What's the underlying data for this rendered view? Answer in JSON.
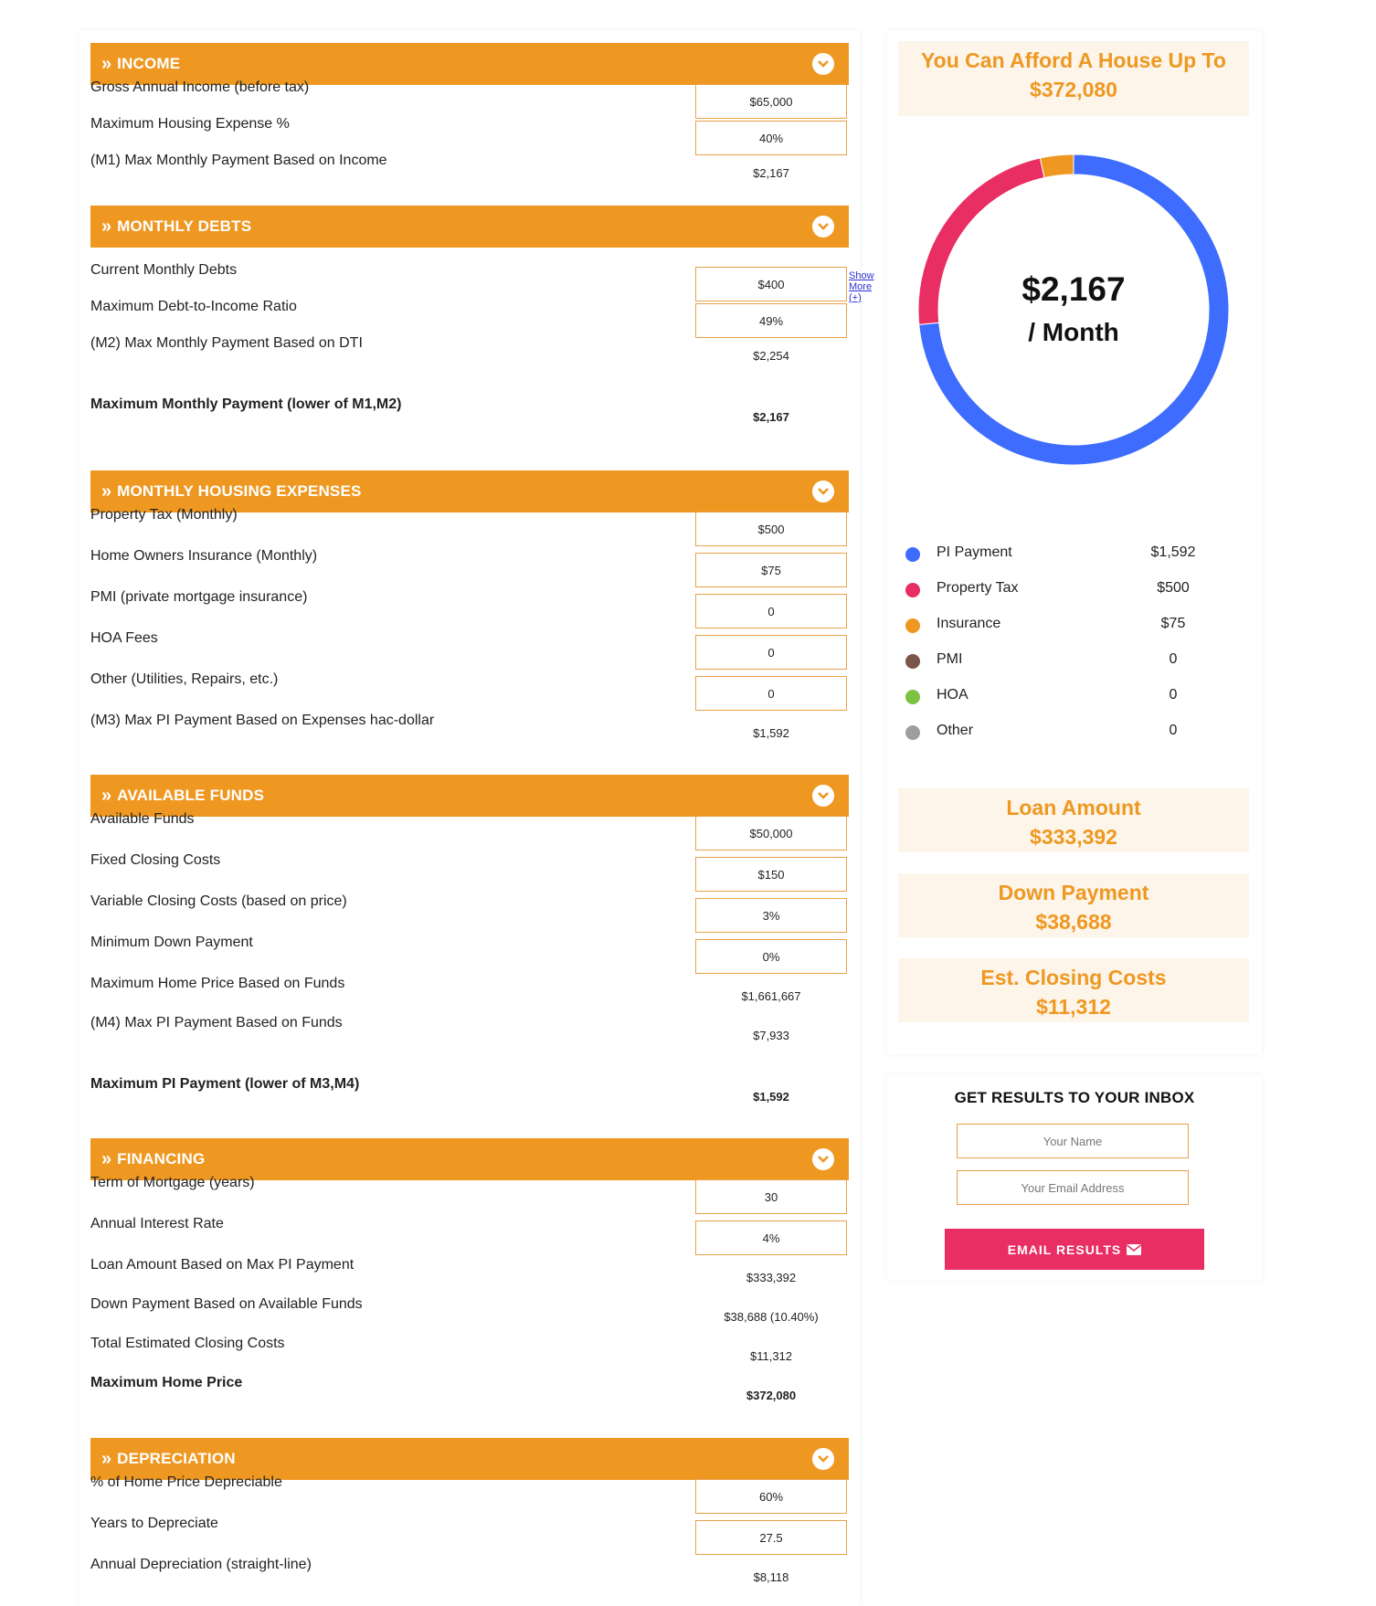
{
  "sections": {
    "income": {
      "title": "INCOME",
      "gross_label": "Gross Annual Income (before tax)",
      "gross_value": "$65,000",
      "max_housing_label": "Maximum Housing Expense %",
      "max_housing_value": "40%",
      "m1_label": "(M1) Max Monthly Payment Based on Income",
      "m1_value": "$2,167"
    },
    "debts": {
      "title": "MONTHLY DEBTS",
      "show_more": "Show More (+)",
      "current_label": "Current Monthly Debts",
      "current_value": "$400",
      "dti_label": "Maximum Debt-to-Income Ratio",
      "dti_value": "49%",
      "m2_label": "(M2) Max Monthly Payment Based on DTI",
      "m2_value": "$2,254",
      "max_label": "Maximum Monthly Payment (lower of M1,M2)",
      "max_value": "$2,167"
    },
    "housing": {
      "title": "MONTHLY HOUSING EXPENSES",
      "tax_label": "Property Tax (Monthly)",
      "tax_value": "$500",
      "ins_label": "Home Owners Insurance (Monthly)",
      "ins_value": "$75",
      "pmi_label": "PMI (private mortgage insurance)",
      "pmi_value": "0",
      "hoa_label": "HOA Fees",
      "hoa_value": "0",
      "other_label": "Other (Utilities, Repairs, etc.)",
      "other_value": "0",
      "m3_label": "(M3) Max PI Payment Based on Expenses hac-dollar",
      "m3_value": "$1,592"
    },
    "funds": {
      "title": "AVAILABLE FUNDS",
      "avail_label": "Available Funds",
      "avail_value": "$50,000",
      "fixed_label": "Fixed Closing Costs",
      "fixed_value": "$150",
      "variable_label": "Variable Closing Costs (based on price)",
      "variable_value": "3%",
      "min_down_label": "Minimum Down Payment",
      "min_down_value": "0%",
      "max_price_label": "Maximum Home Price Based on Funds",
      "max_price_value": "$1,661,667",
      "m4_label": "(M4) Max PI Payment Based on Funds",
      "m4_value": "$7,933",
      "max_pi_label": "Maximum PI Payment (lower of M3,M4)",
      "max_pi_value": "$1,592"
    },
    "financing": {
      "title": "FINANCING",
      "term_label": "Term of Mortgage (years)",
      "term_value": "30",
      "rate_label": "Annual Interest Rate",
      "rate_value": "4%",
      "loan_label": "Loan Amount Based on Max PI Payment",
      "loan_value": "$333,392",
      "down_label": "Down Payment Based on Available Funds",
      "down_value": "$38,688 (10.40%)",
      "closing_label": "Total Estimated Closing Costs",
      "closing_value": "$11,312",
      "max_home_label": "Maximum Home Price",
      "max_home_value": "$372,080"
    },
    "depreciation": {
      "title": "DEPRECIATION",
      "pct_label": "% of Home Price Depreciable",
      "pct_value": "60%",
      "years_label": "Years to Depreciate",
      "years_value": "27.5",
      "annual_label": "Annual Depreciation (straight-line)",
      "annual_value": "$8,118"
    }
  },
  "summary": {
    "afford_title": "You Can Afford A House Up To",
    "afford_value": "$372,080",
    "monthly_amount": "$2,167",
    "monthly_suffix": "/ Month",
    "legend": [
      {
        "name": "PI Payment",
        "value": "$1,592",
        "color": "#3d6cfe",
        "amount": 1592
      },
      {
        "name": "Property Tax",
        "value": "$500",
        "color": "#e82e62",
        "amount": 500
      },
      {
        "name": "Insurance",
        "value": "$75",
        "color": "#ee9822",
        "amount": 75
      },
      {
        "name": "PMI",
        "value": "0",
        "color": "#7a5548",
        "amount": 0
      },
      {
        "name": "HOA",
        "value": "0",
        "color": "#7cc242",
        "amount": 0
      },
      {
        "name": "Other",
        "value": "0",
        "color": "#9e9e9e",
        "amount": 0
      }
    ],
    "loan_title": "Loan Amount",
    "loan_value": "$333,392",
    "down_title": "Down Payment",
    "down_value": "$38,688",
    "closing_title": "Est. Closing Costs",
    "closing_value": "$11,312"
  },
  "email": {
    "heading": "GET RESULTS TO YOUR INBOX",
    "name_placeholder": "Your Name",
    "email_placeholder": "Your Email Address",
    "button_label": "EMAIL RESULTS"
  },
  "colors": {
    "accent": "#ee9822",
    "button": "#e82e62"
  }
}
